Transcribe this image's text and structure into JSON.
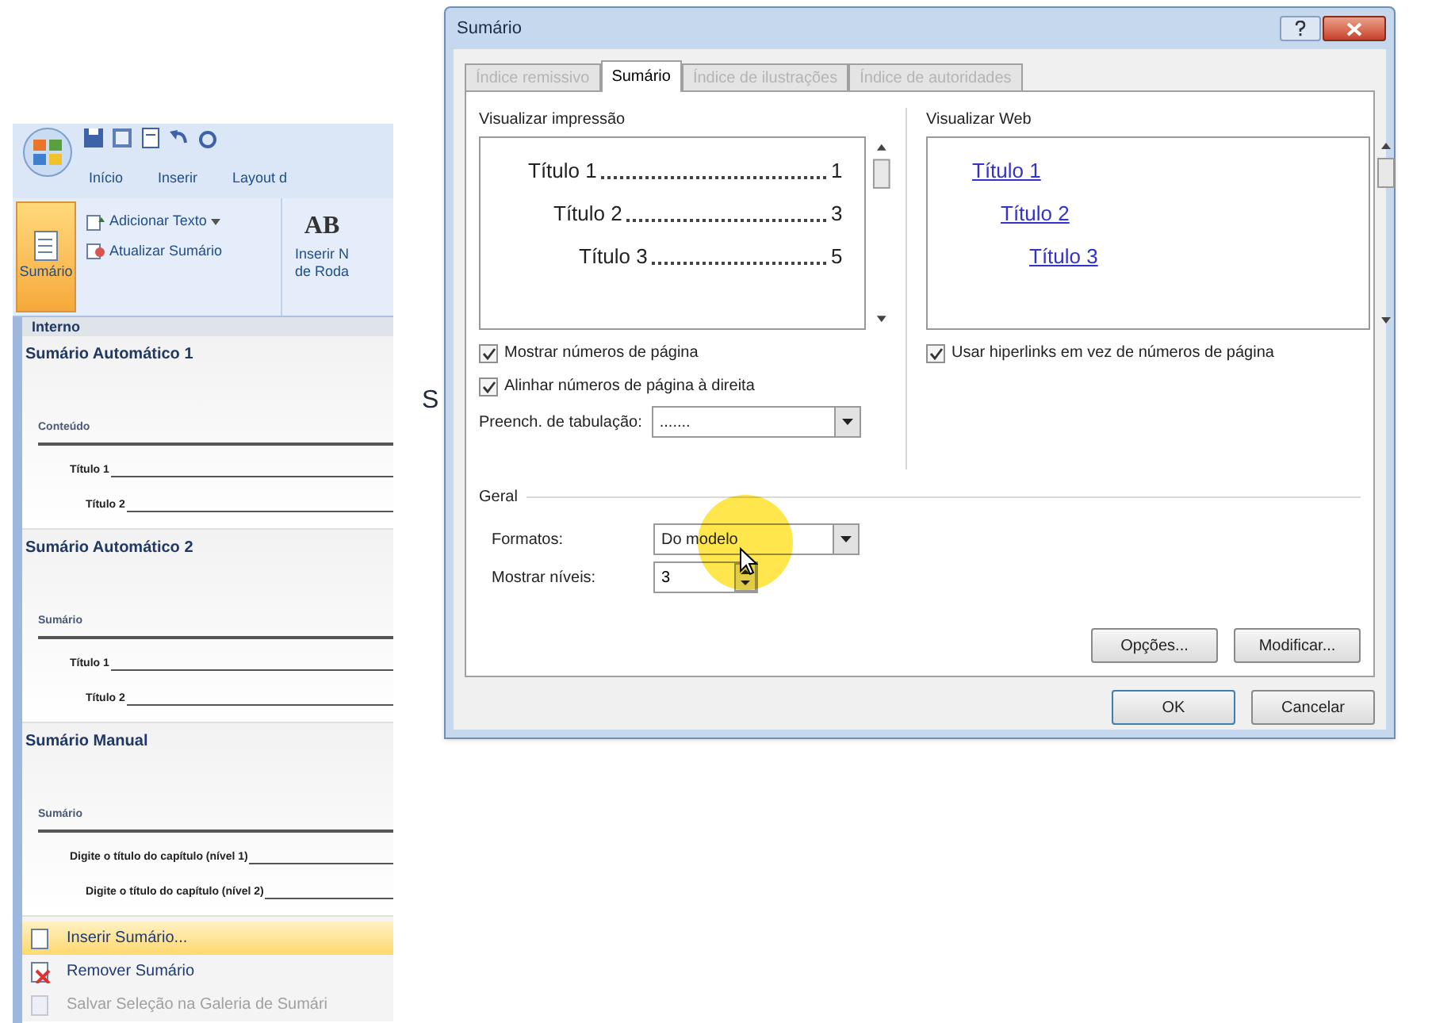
{
  "ribbon": {
    "tabs": [
      "Início",
      "Inserir",
      "Layout d"
    ],
    "toc_button": "Sumário",
    "commands": [
      "Adicionar Texto",
      "Atualizar Sumário"
    ],
    "next_group": {
      "glyph": "AB",
      "lines": [
        "Inserir N",
        "de Roda"
      ]
    }
  },
  "gallery": {
    "header": "Interno",
    "sections": [
      {
        "title": "Sumário Automático 1",
        "heading": "Conteúdo",
        "entries": [
          {
            "text": "Título 1",
            "children": [
              {
                "text": "Título 2"
              }
            ]
          }
        ]
      },
      {
        "title": "Sumário Automático 2",
        "heading": "Sumário",
        "entries": [
          {
            "text": "Título 1",
            "children": [
              {
                "text": "Título 2"
              }
            ]
          }
        ]
      },
      {
        "title": "Sumário Manual",
        "heading": "Sumário",
        "entries": [
          {
            "text": "Digite o título do capítulo (nível 1)",
            "children": [
              {
                "text": "Digite o título do capítulo (nível 2)"
              }
            ]
          }
        ]
      }
    ]
  },
  "menu": [
    {
      "label": "Inserir Sumário...",
      "selected": true,
      "disabled": false
    },
    {
      "label": "Remover Sumário",
      "selected": false,
      "disabled": false
    },
    {
      "label": "Salvar Seleção na Galeria de Sumári",
      "selected": false,
      "disabled": true
    }
  ],
  "fragment": "S",
  "dialog": {
    "title": "Sumário",
    "tabs": [
      {
        "label": "Índice remissivo",
        "selected": false,
        "disabled": true
      },
      {
        "label": "Sumário",
        "selected": true,
        "disabled": false
      },
      {
        "label": "Índice de ilustrações",
        "selected": false,
        "disabled": true
      },
      {
        "label": "Índice de autoridades",
        "selected": false,
        "disabled": true
      }
    ],
    "print_preview": {
      "label": "Visualizar impressão",
      "entries": [
        {
          "text": "Título 1",
          "page": "1",
          "children": [
            {
              "text": "Título 2",
              "page": "3",
              "children": [
                {
                  "text": "Título 3",
                  "page": "5"
                }
              ]
            }
          ]
        }
      ]
    },
    "web_preview": {
      "label": "Visualizar Web",
      "entries": [
        {
          "text": "Título 1",
          "children": [
            {
              "text": "Título 2",
              "children": [
                {
                  "text": "Título 3"
                }
              ]
            }
          ]
        }
      ]
    },
    "checkboxes": [
      {
        "label": "Mostrar números de página",
        "checked": true
      },
      {
        "label": "Alinhar números de página à direita",
        "checked": true
      }
    ],
    "tab_leader": {
      "label": "Preench. de tabulação:",
      "value": "......."
    },
    "web_checkbox": {
      "label": "Usar hiperlinks em vez de números de página",
      "checked": true
    },
    "general": {
      "title": "Geral",
      "formats": {
        "label": "Formatos:",
        "value": "Do modelo"
      },
      "levels": {
        "label": "Mostrar níveis:",
        "value": "3"
      }
    },
    "buttons": [
      "Opções...",
      "Modificar..."
    ],
    "footer_buttons": [
      "OK",
      "Cancelar"
    ]
  }
}
